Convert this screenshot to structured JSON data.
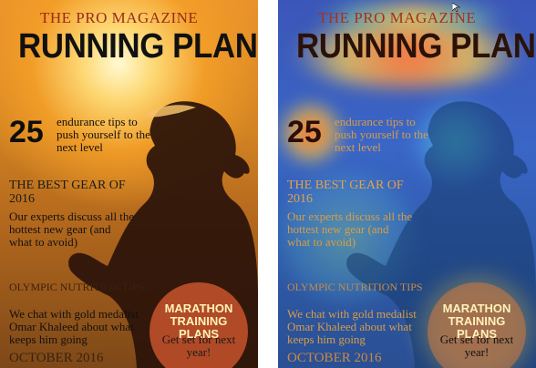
{
  "cover": {
    "magazine": "THE PRO MAGAZINE",
    "title": "RUNNING PLANET",
    "number": "25",
    "tips_text": "endurance tips to push yourself to the next level",
    "best_gear": "THE BEST GEAR OF 2016",
    "experts_text": "Our experts discuss all the hottest new gear (and what to avoid)",
    "olympic": "OLYMPIC NUTRITION TIPS",
    "gold_medalist_text": "We chat with gold medalist Omar Khaleed about what keeps him going",
    "issue_date": "OCTOBER 2016",
    "badge_title": "MARATHON TRAINING PLANS",
    "badge_sub": "Get set for next year!"
  },
  "colors": {
    "original_bg_top": "#e9922b",
    "original_bg_bottom": "#7d4818",
    "heatmap_bg": "#3a66c7",
    "accent": "#cd552d"
  },
  "icons": {
    "cursor": "mouse-cursor-icon"
  }
}
